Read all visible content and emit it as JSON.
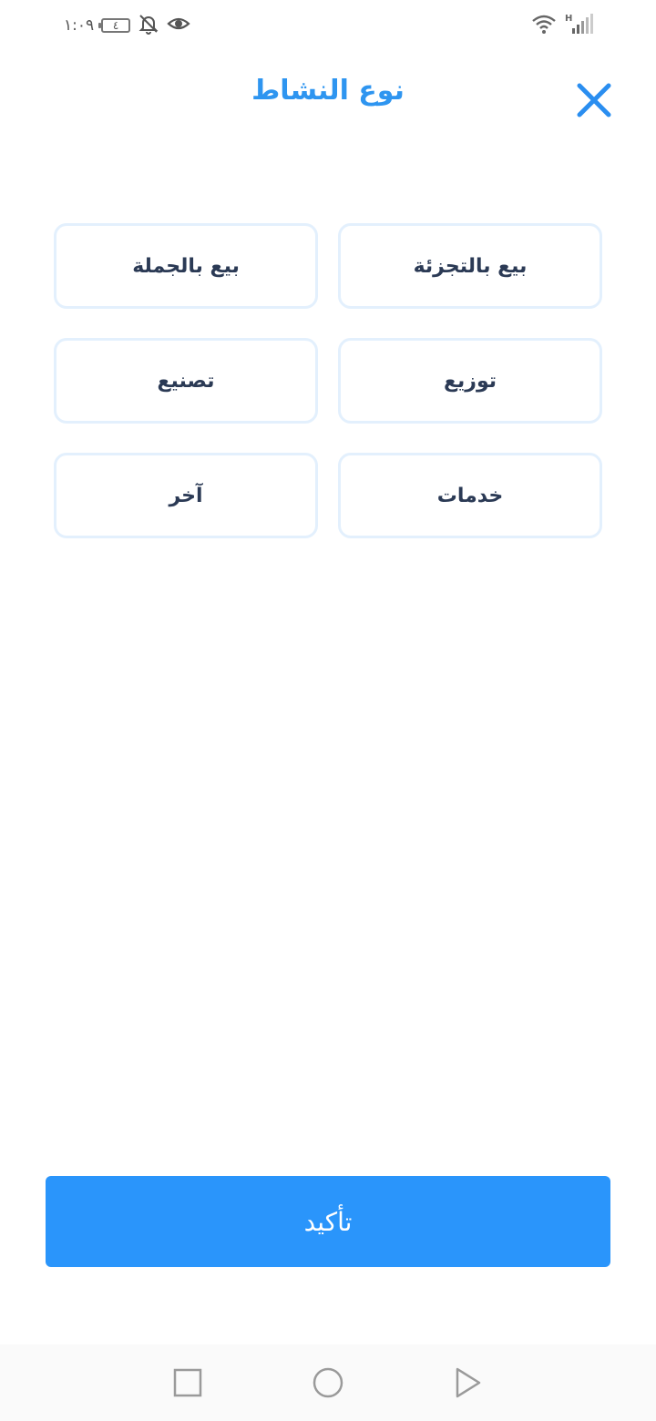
{
  "status_bar": {
    "time": "١:٠٩",
    "battery_level": "٤",
    "icons": [
      "battery-icon",
      "bell-off-icon",
      "eye-icon",
      "wifi-icon",
      "signal-h-icon",
      "signal-bars-icon"
    ]
  },
  "header": {
    "title": "نوع النشاط",
    "close_icon": "close-icon"
  },
  "options": {
    "retail": "بيع بالتجزئة",
    "wholesale": "بيع بالجملة",
    "distribution": "توزيع",
    "manufacturing": "تصنيع",
    "services": "خدمات",
    "other": "آخر"
  },
  "confirm": {
    "label": "تأكيد"
  },
  "nav_bar": {
    "icons": [
      "recent-apps-icon",
      "home-icon",
      "back-icon"
    ]
  },
  "colors": {
    "accent": "#2a95fb",
    "title": "#2e95f0",
    "option_border": "#e3f0fd",
    "option_text": "#2b3a55"
  }
}
